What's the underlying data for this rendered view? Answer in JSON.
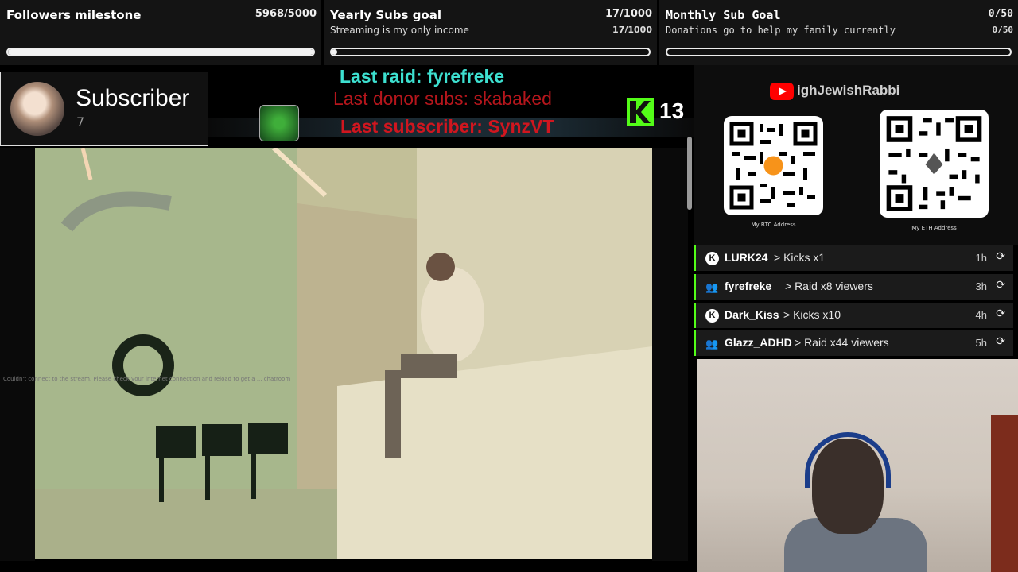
{
  "goals": [
    {
      "title": "Followers milestone",
      "value": "5968/5000",
      "subtitle": "",
      "subvalue": "",
      "progress": 1.0
    },
    {
      "title": "Yearly Subs goal",
      "value": "17/1000",
      "subtitle": "Streaming is my only income",
      "subvalue": "17/1000",
      "progress": 0.017
    },
    {
      "title": "Monthly Sub Goal",
      "value": "0/50",
      "subtitle": "Donations go to help my family currently",
      "subvalue": "0/50",
      "progress": 0.0
    }
  ],
  "subscriber_widget": {
    "label": "Subscriber",
    "count": "7"
  },
  "alerts": {
    "last_raid": "Last raid: fyrefreke",
    "last_donor": "Last donor subs: skabaked",
    "last_subscriber": "Last subscriber: SynzVT"
  },
  "kick_counter": {
    "value": "13"
  },
  "youtube": {
    "channel": "ighJewishRabbi"
  },
  "qr_codes": [
    {
      "caption": "My BTC Address",
      "coin_icon": "bitcoin-icon"
    },
    {
      "caption": "My ETH Address",
      "coin_icon": "ethereum-icon"
    }
  ],
  "events": [
    {
      "icon": "K",
      "name": "LURK24",
      "desc": "> Kicks x1",
      "time": "1h"
    },
    {
      "icon": "group",
      "name": "fyrefreke",
      "desc": "> Raid x8 viewers",
      "time": "3h"
    },
    {
      "icon": "K",
      "name": "Dark_Kiss",
      "desc": "> Kicks x10",
      "time": "4h"
    },
    {
      "icon": "group",
      "name": "Glazz_ADHD",
      "desc": "> Raid x44 viewers",
      "time": "5h"
    }
  ],
  "video_error": "Couldn't connect to the stream. Please check your internet connection and reload to get a ... chatroom",
  "colors": {
    "kick_green": "#53fc18",
    "raid_cyan": "#3de0d0",
    "alert_red": "#d0161f",
    "youtube_red": "#ff0000"
  }
}
